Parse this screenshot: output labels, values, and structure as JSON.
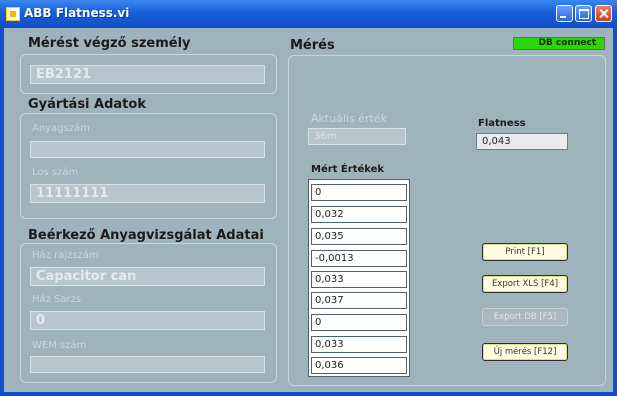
{
  "window": {
    "title": "ABB Flatness.vi"
  },
  "operator": {
    "title": "Mérést végző személy",
    "value": "EB2121"
  },
  "production": {
    "title": "Gyártási Adatok",
    "material_label": "Anyagszám",
    "material_value": "",
    "lot_label": "Los szám",
    "lot_value": "11111111"
  },
  "incoming": {
    "title": "Beérkező Anyagvizsgálat Adatai",
    "drawing_label": "Ház rajzszám",
    "drawing_value": "Capacitor can",
    "batch_label": "Ház Sarzs",
    "batch_value": "0",
    "wem_label": "WEM szám",
    "wem_value": ""
  },
  "measurement": {
    "title": "Mérés",
    "db_connect": "DB connect",
    "current_label": "Aktuális érték",
    "current_value": "36m",
    "flatness_label": "Flatness",
    "flatness_value": "0,043",
    "values_label": "Mért Értékek",
    "values": [
      "0",
      "0,032",
      "0,035",
      "-0,0013",
      "0,033",
      "0,037",
      "0",
      "0,033",
      "0,036"
    ]
  },
  "buttons": {
    "print": "Print [F1]",
    "export_xls": "Export XLS [F4]",
    "export_db": "Export DB [F5]",
    "new": "Új mérés [F12]"
  },
  "colors": {
    "panel": "#9fb3bd",
    "titlebar": "#1a5fd8",
    "led_on": "#2cd40a"
  }
}
